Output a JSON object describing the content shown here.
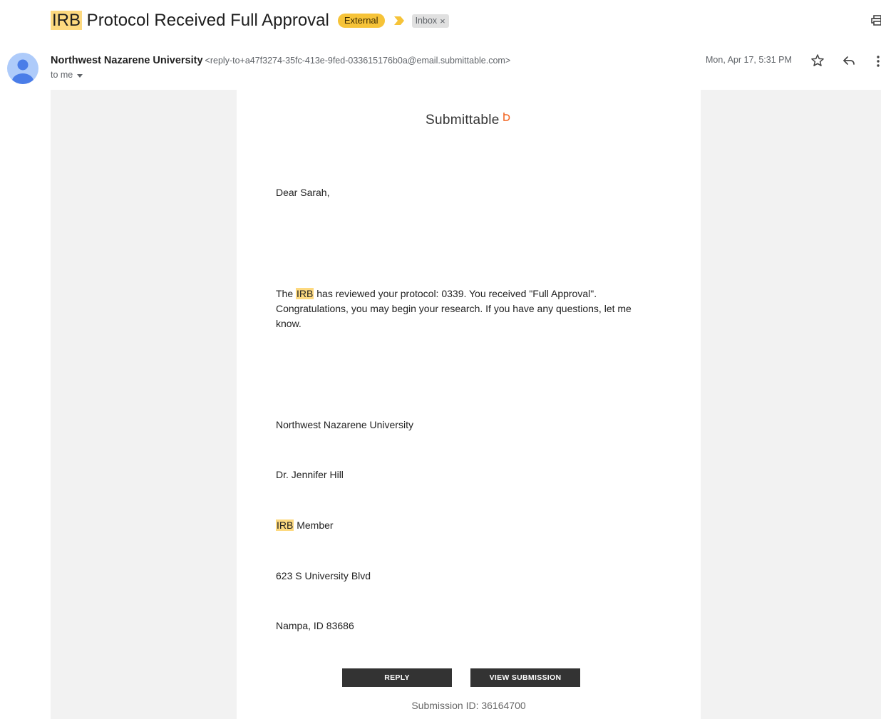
{
  "subject": {
    "highlight": "IRB",
    "rest": " Protocol Received Full Approval",
    "labels": {
      "external": "External",
      "inbox": "Inbox",
      "inbox_remove": "×"
    }
  },
  "sender": {
    "name": "Northwest Nazarene University",
    "email": "<reply-to+a47f3274-35fc-413e-9fed-033615176b0a@email.submittable.com>",
    "to": "to me",
    "date": "Mon, Apr 17, 5:31 PM"
  },
  "icons": {
    "print": "print-icon",
    "avatar": "person-avatar-icon",
    "important": "important-marker-icon",
    "star": "star-icon",
    "reply": "reply-icon",
    "more": "more-vertical-icon",
    "logo_mark": "submittable-logo-mark"
  },
  "colors": {
    "highlight": "#fdd97f",
    "external_label": "#f6c338",
    "button": "#333333",
    "logo_accent": "#f26522",
    "avatar": "#aecbfa",
    "avatar_figure": "#4a7de8"
  },
  "email": {
    "logo_text": "Submittable",
    "greeting": "Dear Sarah,",
    "body": {
      "prefix": "The ",
      "highlight": "IRB",
      "line1": " has reviewed your protocol: 0339.  You received \"Full Approval\".",
      "line2": " Congratulations, you may begin your research.  If you have any questions, let me",
      "line3": "know."
    },
    "signature": {
      "org": "Northwest Nazarene University",
      "name": "Dr. Jennifer Hill",
      "role_highlight": "IRB",
      "role_rest": " Member",
      "street": "623 S University Blvd",
      "city": "Nampa, ID  83686"
    },
    "buttons": {
      "reply": "REPLY",
      "view": "VIEW SUBMISSION"
    },
    "submission_id": "Submission ID: 36164700"
  }
}
